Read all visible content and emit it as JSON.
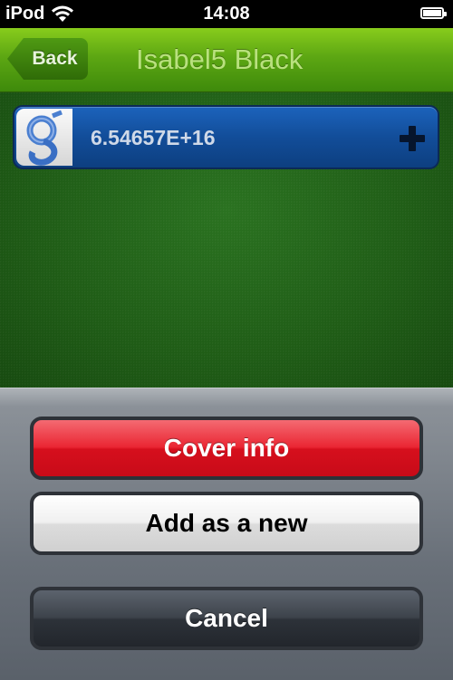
{
  "status_bar": {
    "carrier": "iPod",
    "time": "14:08",
    "icons": [
      "wifi-icon",
      "battery-icon"
    ]
  },
  "nav_bar": {
    "back_label": "Back",
    "title": "Isabel5 Black"
  },
  "contact_card": {
    "value": "6.54657E+16",
    "logo": "google-logo-icon",
    "action_icon": "plus-icon"
  },
  "action_sheet": {
    "cover_label": "Cover info",
    "add_label": "Add as a new",
    "cancel_label": "Cancel"
  },
  "colors": {
    "nav_green": "#5da713",
    "felt_green": "#1f5c16",
    "card_blue": "#124d99",
    "destructive_red": "#ea2633"
  }
}
